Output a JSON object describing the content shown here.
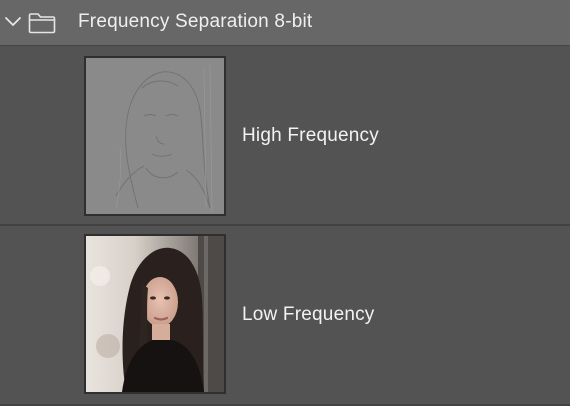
{
  "group": {
    "title": "Frequency Separation 8-bit",
    "expanded": true,
    "chevron_icon": "chevron-down-icon",
    "folder_icon": "folder-icon"
  },
  "layers": [
    {
      "name": "High Frequency",
      "thumbnail": "high-pass-portrait-thumbnail"
    },
    {
      "name": "Low Frequency",
      "thumbnail": "portrait-photo-thumbnail"
    }
  ],
  "colors": {
    "panel_bg": "#535353",
    "group_bg": "#676767",
    "text": "#f2f2f2"
  }
}
